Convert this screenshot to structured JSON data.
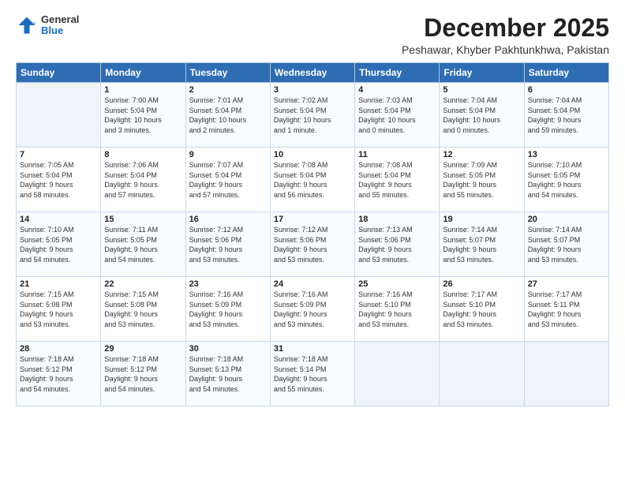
{
  "header": {
    "logo_general": "General",
    "logo_blue": "Blue",
    "month_title": "December 2025",
    "subtitle": "Peshawar, Khyber Pakhtunkhwa, Pakistan"
  },
  "weekdays": [
    "Sunday",
    "Monday",
    "Tuesday",
    "Wednesday",
    "Thursday",
    "Friday",
    "Saturday"
  ],
  "weeks": [
    [
      {
        "day": "",
        "info": ""
      },
      {
        "day": "1",
        "info": "Sunrise: 7:00 AM\nSunset: 5:04 PM\nDaylight: 10 hours\nand 3 minutes."
      },
      {
        "day": "2",
        "info": "Sunrise: 7:01 AM\nSunset: 5:04 PM\nDaylight: 10 hours\nand 2 minutes."
      },
      {
        "day": "3",
        "info": "Sunrise: 7:02 AM\nSunset: 5:04 PM\nDaylight: 10 hours\nand 1 minute."
      },
      {
        "day": "4",
        "info": "Sunrise: 7:03 AM\nSunset: 5:04 PM\nDaylight: 10 hours\nand 0 minutes."
      },
      {
        "day": "5",
        "info": "Sunrise: 7:04 AM\nSunset: 5:04 PM\nDaylight: 10 hours\nand 0 minutes."
      },
      {
        "day": "6",
        "info": "Sunrise: 7:04 AM\nSunset: 5:04 PM\nDaylight: 9 hours\nand 59 minutes."
      }
    ],
    [
      {
        "day": "7",
        "info": "Sunrise: 7:05 AM\nSunset: 5:04 PM\nDaylight: 9 hours\nand 58 minutes."
      },
      {
        "day": "8",
        "info": "Sunrise: 7:06 AM\nSunset: 5:04 PM\nDaylight: 9 hours\nand 57 minutes."
      },
      {
        "day": "9",
        "info": "Sunrise: 7:07 AM\nSunset: 5:04 PM\nDaylight: 9 hours\nand 57 minutes."
      },
      {
        "day": "10",
        "info": "Sunrise: 7:08 AM\nSunset: 5:04 PM\nDaylight: 9 hours\nand 56 minutes."
      },
      {
        "day": "11",
        "info": "Sunrise: 7:08 AM\nSunset: 5:04 PM\nDaylight: 9 hours\nand 55 minutes."
      },
      {
        "day": "12",
        "info": "Sunrise: 7:09 AM\nSunset: 5:05 PM\nDaylight: 9 hours\nand 55 minutes."
      },
      {
        "day": "13",
        "info": "Sunrise: 7:10 AM\nSunset: 5:05 PM\nDaylight: 9 hours\nand 54 minutes."
      }
    ],
    [
      {
        "day": "14",
        "info": "Sunrise: 7:10 AM\nSunset: 5:05 PM\nDaylight: 9 hours\nand 54 minutes."
      },
      {
        "day": "15",
        "info": "Sunrise: 7:11 AM\nSunset: 5:05 PM\nDaylight: 9 hours\nand 54 minutes."
      },
      {
        "day": "16",
        "info": "Sunrise: 7:12 AM\nSunset: 5:06 PM\nDaylight: 9 hours\nand 53 minutes."
      },
      {
        "day": "17",
        "info": "Sunrise: 7:12 AM\nSunset: 5:06 PM\nDaylight: 9 hours\nand 53 minutes."
      },
      {
        "day": "18",
        "info": "Sunrise: 7:13 AM\nSunset: 5:06 PM\nDaylight: 9 hours\nand 53 minutes."
      },
      {
        "day": "19",
        "info": "Sunrise: 7:14 AM\nSunset: 5:07 PM\nDaylight: 9 hours\nand 53 minutes."
      },
      {
        "day": "20",
        "info": "Sunrise: 7:14 AM\nSunset: 5:07 PM\nDaylight: 9 hours\nand 53 minutes."
      }
    ],
    [
      {
        "day": "21",
        "info": "Sunrise: 7:15 AM\nSunset: 5:08 PM\nDaylight: 9 hours\nand 53 minutes."
      },
      {
        "day": "22",
        "info": "Sunrise: 7:15 AM\nSunset: 5:08 PM\nDaylight: 9 hours\nand 53 minutes."
      },
      {
        "day": "23",
        "info": "Sunrise: 7:16 AM\nSunset: 5:09 PM\nDaylight: 9 hours\nand 53 minutes."
      },
      {
        "day": "24",
        "info": "Sunrise: 7:16 AM\nSunset: 5:09 PM\nDaylight: 9 hours\nand 53 minutes."
      },
      {
        "day": "25",
        "info": "Sunrise: 7:16 AM\nSunset: 5:10 PM\nDaylight: 9 hours\nand 53 minutes."
      },
      {
        "day": "26",
        "info": "Sunrise: 7:17 AM\nSunset: 5:10 PM\nDaylight: 9 hours\nand 53 minutes."
      },
      {
        "day": "27",
        "info": "Sunrise: 7:17 AM\nSunset: 5:11 PM\nDaylight: 9 hours\nand 53 minutes."
      }
    ],
    [
      {
        "day": "28",
        "info": "Sunrise: 7:18 AM\nSunset: 5:12 PM\nDaylight: 9 hours\nand 54 minutes."
      },
      {
        "day": "29",
        "info": "Sunrise: 7:18 AM\nSunset: 5:12 PM\nDaylight: 9 hours\nand 54 minutes."
      },
      {
        "day": "30",
        "info": "Sunrise: 7:18 AM\nSunset: 5:13 PM\nDaylight: 9 hours\nand 54 minutes."
      },
      {
        "day": "31",
        "info": "Sunrise: 7:18 AM\nSunset: 5:14 PM\nDaylight: 9 hours\nand 55 minutes."
      },
      {
        "day": "",
        "info": ""
      },
      {
        "day": "",
        "info": ""
      },
      {
        "day": "",
        "info": ""
      }
    ]
  ]
}
